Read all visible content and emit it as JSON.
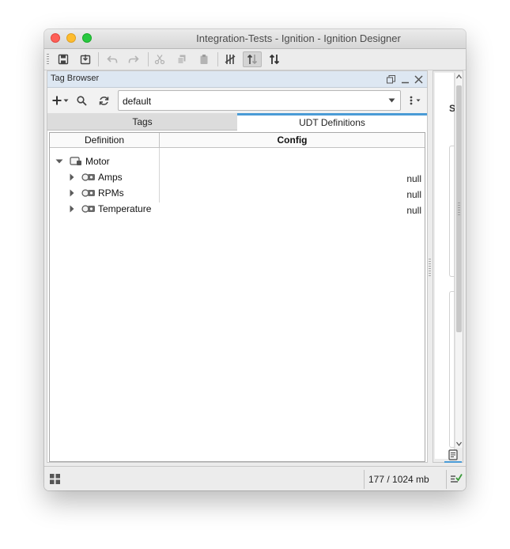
{
  "window": {
    "title": "Integration-Tests - Ignition - Ignition Designer"
  },
  "toolbar": {
    "buttons": [
      "save-icon",
      "save-all-icon",
      "undo-icon",
      "redo-icon",
      "cut-icon",
      "copy-icon",
      "paste-icon",
      "comms-off-icon",
      "comms-read-only-icon",
      "comms-read-write-icon"
    ]
  },
  "tag_browser": {
    "title": "Tag Browser",
    "provider_value": "default",
    "tabs": [
      {
        "label": "Tags",
        "active": false
      },
      {
        "label": "UDT Definitions",
        "active": true
      }
    ],
    "columns": {
      "definition": "Definition",
      "config": "Config"
    },
    "rows": [
      {
        "name": "Motor",
        "config": "",
        "expanded": true,
        "level": 0
      },
      {
        "name": "Amps",
        "config": "null",
        "expanded": false,
        "level": 1
      },
      {
        "name": "RPMs",
        "config": "null",
        "expanded": false,
        "level": 1
      },
      {
        "name": "Temperature",
        "config": "null",
        "expanded": false,
        "level": 1
      }
    ]
  },
  "right_pane": {
    "letter": "S"
  },
  "status_bar": {
    "memory": "177 / 1024 mb"
  },
  "colors": {
    "accent": "#4a9bd6",
    "panel_header": "#dde7f2"
  }
}
